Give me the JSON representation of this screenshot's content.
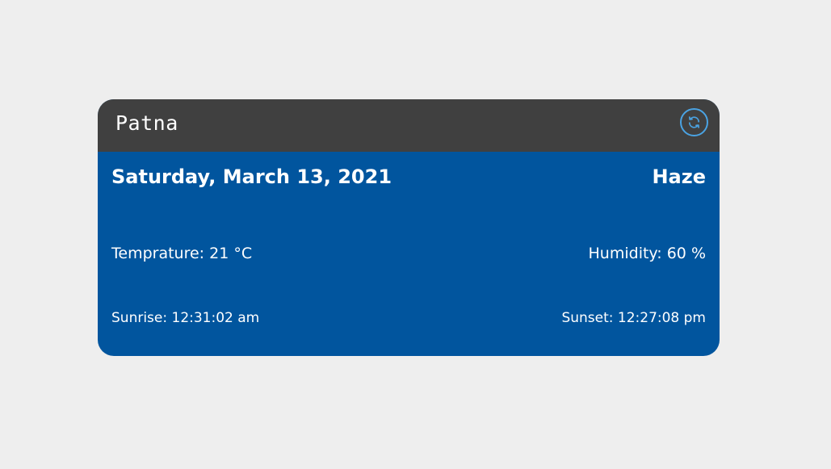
{
  "weather": {
    "city": "Patna",
    "date": "Saturday, March 13, 2021",
    "condition": "Haze",
    "temperature_label": "Temprature: 21 °C",
    "humidity_label": "Humidity: 60 %",
    "sunrise_label": "Sunrise: 12:31:02 am",
    "sunset_label": "Sunset: 12:27:08 pm",
    "refresh_icon": "refresh-icon"
  },
  "colors": {
    "background": "#eeeeee",
    "header": "#404040",
    "body": "#01559e",
    "accent": "#4aa3e3",
    "text": "#ffffff"
  }
}
